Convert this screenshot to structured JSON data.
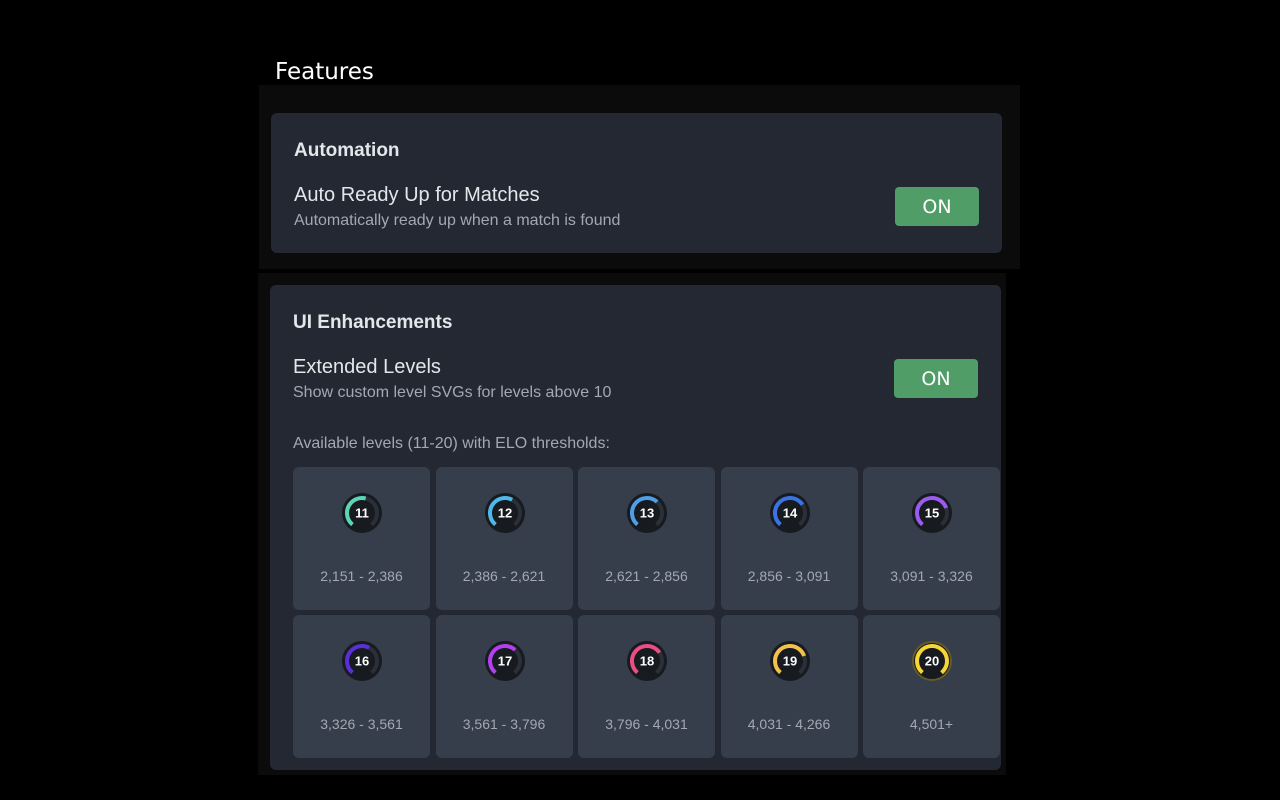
{
  "page_title": "Features",
  "automation": {
    "title": "Automation",
    "setting": {
      "name": "Auto Ready Up for Matches",
      "description": "Automatically ready up when a match is found",
      "toggle_label": "ON",
      "enabled": true
    }
  },
  "ui_enhancements": {
    "title": "UI Enhancements",
    "setting": {
      "name": "Extended Levels",
      "description": "Show custom level SVGs for levels above 10",
      "toggle_label": "ON",
      "enabled": true
    },
    "levels_caption": "Available levels (11-20) with ELO thresholds:",
    "levels": [
      {
        "level": "11",
        "range": "2,151 - 2,386",
        "color": "#5ad6b4",
        "progress": 0.55
      },
      {
        "level": "12",
        "range": "2,386 - 2,621",
        "color": "#4fb8ea",
        "progress": 0.6
      },
      {
        "level": "13",
        "range": "2,621 - 2,856",
        "color": "#4f9ee8",
        "progress": 0.65
      },
      {
        "level": "14",
        "range": "2,856 - 3,091",
        "color": "#3b73e6",
        "progress": 0.7
      },
      {
        "level": "15",
        "range": "3,091 - 3,326",
        "color": "#9a5bee",
        "progress": 0.75
      },
      {
        "level": "16",
        "range": "3,326 - 3,561",
        "color": "#5a2fd8",
        "progress": 0.6
      },
      {
        "level": "17",
        "range": "3,561 - 3,796",
        "color": "#b43ff0",
        "progress": 0.65
      },
      {
        "level": "18",
        "range": "3,796 - 4,031",
        "color": "#ec4d84",
        "progress": 0.7
      },
      {
        "level": "19",
        "range": "4,031 - 4,266",
        "color": "#f3c04a",
        "progress": 0.75
      },
      {
        "level": "20",
        "range": "4,501+",
        "color": "#f6d536",
        "progress": 1.0
      }
    ]
  },
  "colors": {
    "card_bg": "#232833",
    "tile_bg": "#363d4b",
    "toggle_on": "#519d67",
    "badge_bg": "#171a1f",
    "badge_track": "#2b2f37"
  }
}
